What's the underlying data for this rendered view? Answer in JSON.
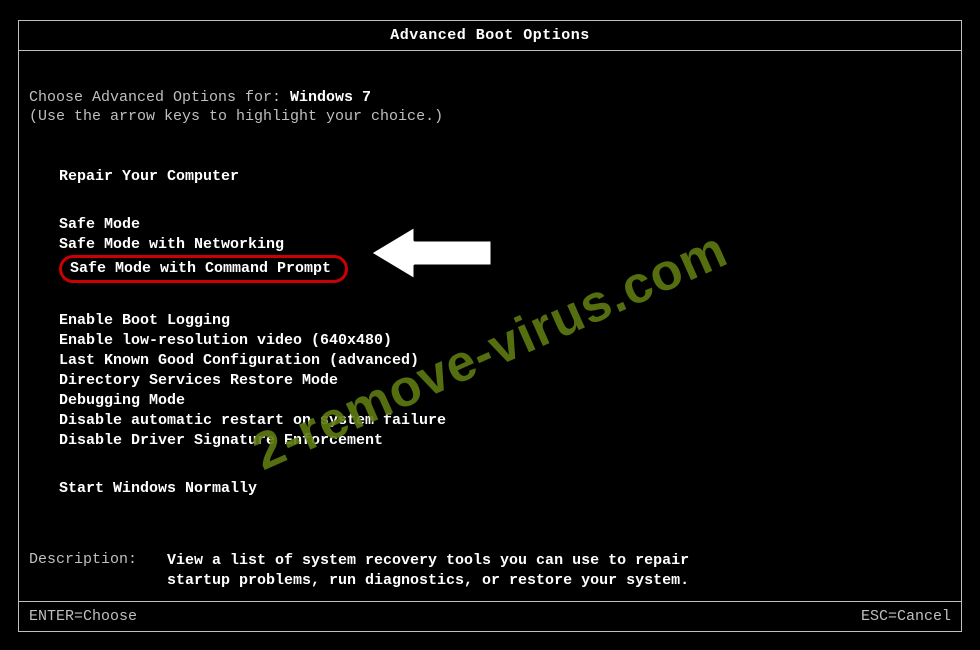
{
  "title": "Advanced Boot Options",
  "intro": {
    "line1_prefix": "Choose Advanced Options for: ",
    "os_name": "Windows 7",
    "line2": "(Use the arrow keys to highlight your choice.)"
  },
  "menu": {
    "group1": [
      "Repair Your Computer"
    ],
    "group2": [
      "Safe Mode",
      "Safe Mode with Networking",
      "Safe Mode with Command Prompt"
    ],
    "group3": [
      "Enable Boot Logging",
      "Enable low-resolution video (640x480)",
      "Last Known Good Configuration (advanced)",
      "Directory Services Restore Mode",
      "Debugging Mode",
      "Disable automatic restart on system failure",
      "Disable Driver Signature Enforcement"
    ],
    "group4": [
      "Start Windows Normally"
    ],
    "highlighted_index_group2": 2
  },
  "description": {
    "label": "Description:",
    "text": "View a list of system recovery tools you can use to repair startup problems, run diagnostics, or restore your system."
  },
  "footer": {
    "left": "ENTER=Choose",
    "right": "ESC=Cancel"
  },
  "watermark": "2-remove-virus.com",
  "colors": {
    "highlight_border": "#cc0000",
    "watermark": "#5e7a12"
  }
}
